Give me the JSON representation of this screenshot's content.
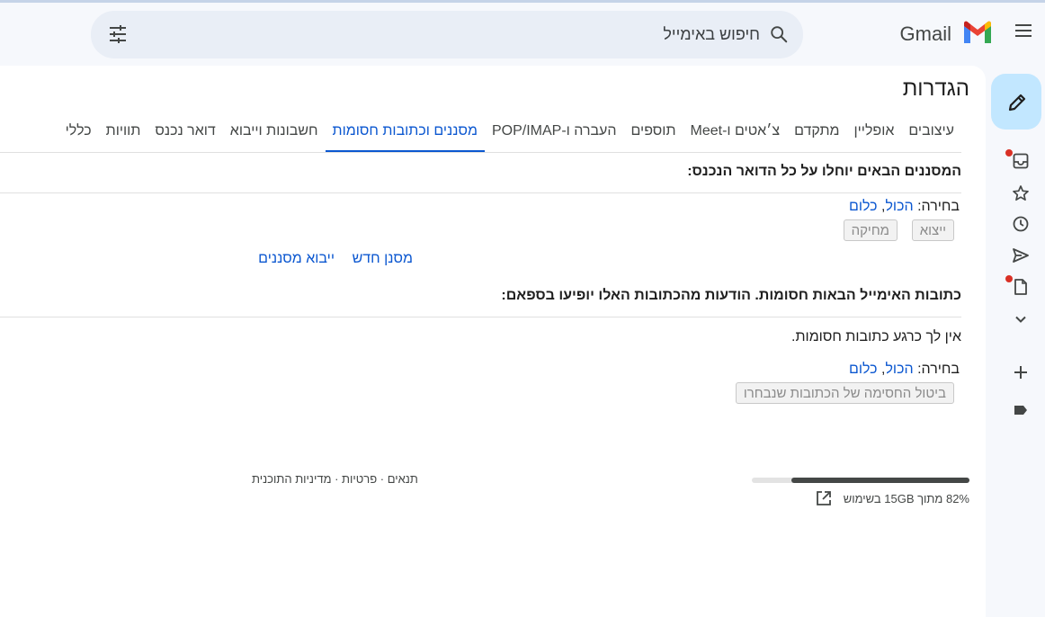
{
  "header": {
    "logo_text": "Gmail",
    "search_placeholder": "חיפוש באימייל"
  },
  "settings": {
    "title": "הגדרות",
    "tabs": [
      {
        "label": "כללי"
      },
      {
        "label": "תוויות"
      },
      {
        "label": "דואר נכנס"
      },
      {
        "label": "חשבונות וייבוא"
      },
      {
        "label": "מסננים וכתובות חסומות",
        "active": true
      },
      {
        "label": "העברה ו-POP/IMAP"
      },
      {
        "label": "תוספים"
      },
      {
        "label": "צ׳אטים ו-Meet"
      },
      {
        "label": "מתקדם"
      },
      {
        "label": "אופליין"
      },
      {
        "label": "עיצובים"
      }
    ]
  },
  "filters": {
    "heading": "המסננים הבאים יוחלו על כל הדואר הנכנס:",
    "select_label": "בחירה:",
    "select_all": "הכול",
    "select_none": "כלום",
    "comma": ",",
    "export_button": "ייצוא",
    "delete_button": "מחיקה",
    "new_filter_link": "מסנן חדש",
    "import_filters_link": "ייבוא מסננים"
  },
  "blocked": {
    "heading": "כתובות האימייל הבאות חסומות. הודעות מהכתובות האלו יופיעו בספאם:",
    "empty_text": "אין לך כרגע כתובות חסומות.",
    "select_label": "בחירה:",
    "select_all": "הכול",
    "select_none": "כלום",
    "comma": ",",
    "unblock_button": "ביטול החסימה של הכתובות שנבחרו"
  },
  "footer": {
    "storage_text": "82% מתוך 15GB בשימוש",
    "storage_fraction": 0.82,
    "links": "תנאים · פרטיות · מדיניות התוכנית"
  },
  "colors": {
    "accent": "#0b57d0",
    "compose_bg": "#c2e7ff",
    "notification_dot": "#d93025"
  }
}
